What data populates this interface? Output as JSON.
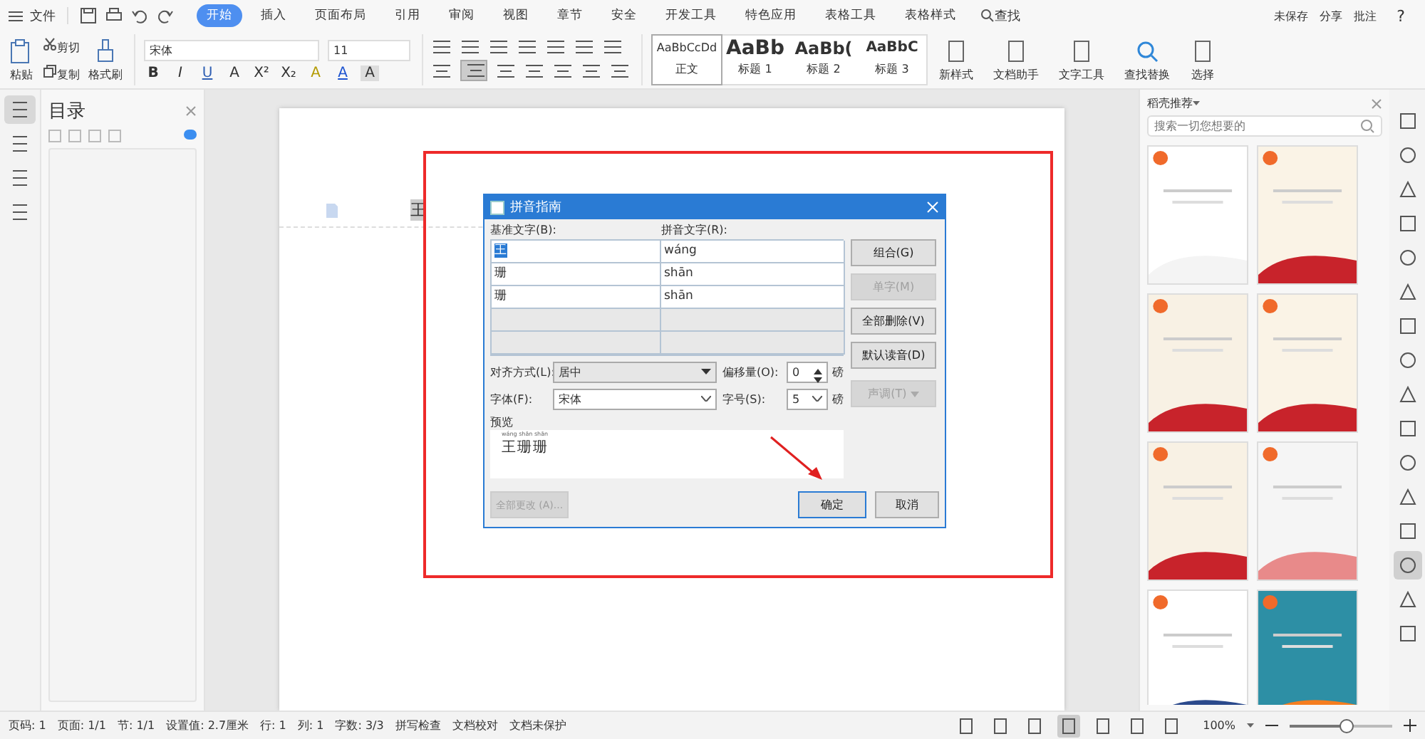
{
  "menu_bar": {
    "file": "文件",
    "tabs": [
      {
        "label": "开始",
        "selected": true
      },
      {
        "label": "插入",
        "selected": false
      },
      {
        "label": "页面布局",
        "selected": false
      },
      {
        "label": "引用",
        "selected": false
      },
      {
        "label": "审阅",
        "selected": false
      },
      {
        "label": "视图",
        "selected": false
      },
      {
        "label": "章节",
        "selected": false
      },
      {
        "label": "安全",
        "selected": false
      },
      {
        "label": "开发工具",
        "selected": false
      },
      {
        "label": "特色应用",
        "selected": false
      },
      {
        "label": "表格工具",
        "selected": false
      },
      {
        "label": "表格样式",
        "selected": false
      }
    ],
    "search": "查找",
    "actions": [
      "未保存",
      "分享",
      "批注"
    ],
    "help": "?"
  },
  "ribbon": {
    "paste": "粘贴",
    "cut": "剪切",
    "copy": "复制",
    "format_painter": "格式刷",
    "font_name": "宋体",
    "font_size": "11",
    "format_glyphs": [
      "B",
      "I",
      "U",
      "A",
      "X²",
      "X₂",
      "A",
      "A",
      "A"
    ],
    "styles": [
      {
        "sample": "AaBbCcDd",
        "label": "正文",
        "selected": true
      },
      {
        "sample": "AaBb",
        "label": "标题 1",
        "selected": false
      },
      {
        "sample": "AaBb(",
        "label": "标题 2",
        "selected": false
      },
      {
        "sample": "AaBbC",
        "label": "标题 3",
        "selected": false
      }
    ],
    "tools": [
      "新样式",
      "文档助手",
      "文字工具",
      "查找替换",
      "选择"
    ]
  },
  "left_toolbar": [
    {
      "selected": true
    },
    {
      "selected": false
    },
    {
      "selected": false
    },
    {
      "selected": false
    }
  ],
  "toc": {
    "title": "目录"
  },
  "document": {
    "text": "王"
  },
  "dialog": {
    "title": "拼音指南",
    "base_label": "基准文字(B):",
    "pinyin_label": "拼音文字(R):",
    "rows": [
      {
        "base": "王",
        "pinyin": "wáng",
        "selected": true
      },
      {
        "base": "珊",
        "pinyin": "shān",
        "selected": false
      },
      {
        "base": "珊",
        "pinyin": "shān",
        "selected": false
      }
    ],
    "side_buttons": [
      {
        "label": "组合(G)",
        "disabled": false
      },
      {
        "label": "单字(M)",
        "disabled": true
      },
      {
        "label": "全部删除(V)",
        "disabled": false
      },
      {
        "label": "默认读音(D)",
        "disabled": false
      }
    ],
    "alignment": {
      "label": "对齐方式(L):",
      "value": "居中"
    },
    "offset": {
      "label": "偏移量(O):",
      "value": "0",
      "unit": "磅"
    },
    "font": {
      "label": "字体(F):",
      "value": "宋体"
    },
    "size": {
      "label": "字号(S):",
      "value": "5",
      "unit": "磅"
    },
    "tone": {
      "label": "声调(T)",
      "disabled": true
    },
    "preview": {
      "label": "预览",
      "ruby": "wáng shān shān",
      "text": "王珊珊"
    },
    "change_all": {
      "label": "全部更改 (A)...",
      "disabled": true
    },
    "ok": "确定",
    "cancel": "取消"
  },
  "right_panel": {
    "title": "稻壳推荐",
    "search_placeholder": "搜索一切您想要的"
  },
  "right_toolbar": [
    {
      "selected": false
    },
    {
      "selected": false
    },
    {
      "selected": false
    },
    {
      "selected": false
    },
    {
      "selected": false
    },
    {
      "selected": false
    },
    {
      "selected": false
    },
    {
      "selected": false
    },
    {
      "selected": false
    },
    {
      "selected": false
    },
    {
      "selected": false
    },
    {
      "selected": false
    },
    {
      "selected": false
    },
    {
      "selected": true
    },
    {
      "selected": false
    },
    {
      "selected": false
    }
  ],
  "status_bar": {
    "items": [
      "页码: 1",
      "页面: 1/1",
      "节: 1/1",
      "设置值: 2.7厘米",
      "行: 1",
      "列: 1",
      "字数: 3/3",
      "拼写检查",
      "文档校对",
      "文档未保护"
    ],
    "views": [
      {
        "selected": false
      },
      {
        "selected": false
      },
      {
        "selected": false
      },
      {
        "selected": true
      },
      {
        "selected": false
      },
      {
        "selected": false
      },
      {
        "selected": false
      }
    ],
    "zoom": "100%",
    "zoom_level": {
      "level": 0.54
    }
  }
}
